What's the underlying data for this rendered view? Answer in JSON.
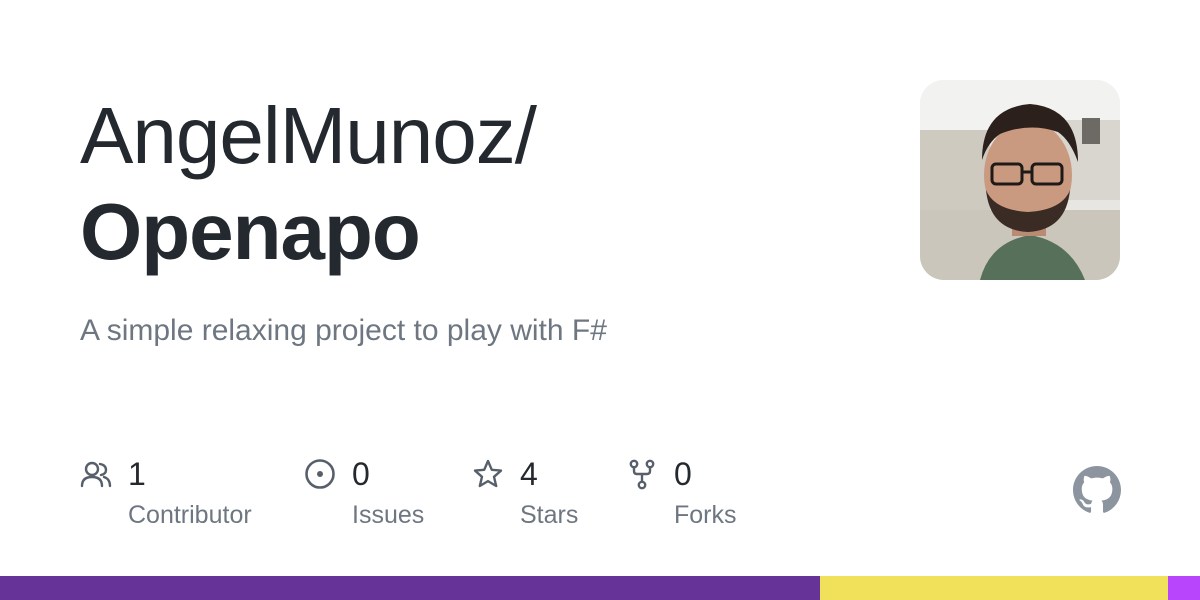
{
  "repo": {
    "owner": "AngelMunoz/",
    "name": "Openapo",
    "description": "A simple relaxing project to play with F#"
  },
  "stats": [
    {
      "icon": "people-icon",
      "count": "1",
      "label": "Contributor"
    },
    {
      "icon": "issue-icon",
      "count": "0",
      "label": "Issues"
    },
    {
      "icon": "star-icon",
      "count": "4",
      "label": "Stars"
    },
    {
      "icon": "fork-icon",
      "count": "0",
      "label": "Forks"
    }
  ],
  "language_bar": [
    {
      "color": "#663399",
      "fraction": 0.6833
    },
    {
      "color": "#f1e05a",
      "fraction": 0.29
    },
    {
      "color": "#b845fc",
      "fraction": 0.0267
    }
  ],
  "colors": {
    "title": "#24292f",
    "muted": "#6e7781",
    "icon": "#57606a",
    "github_logo": "#8c959f"
  }
}
